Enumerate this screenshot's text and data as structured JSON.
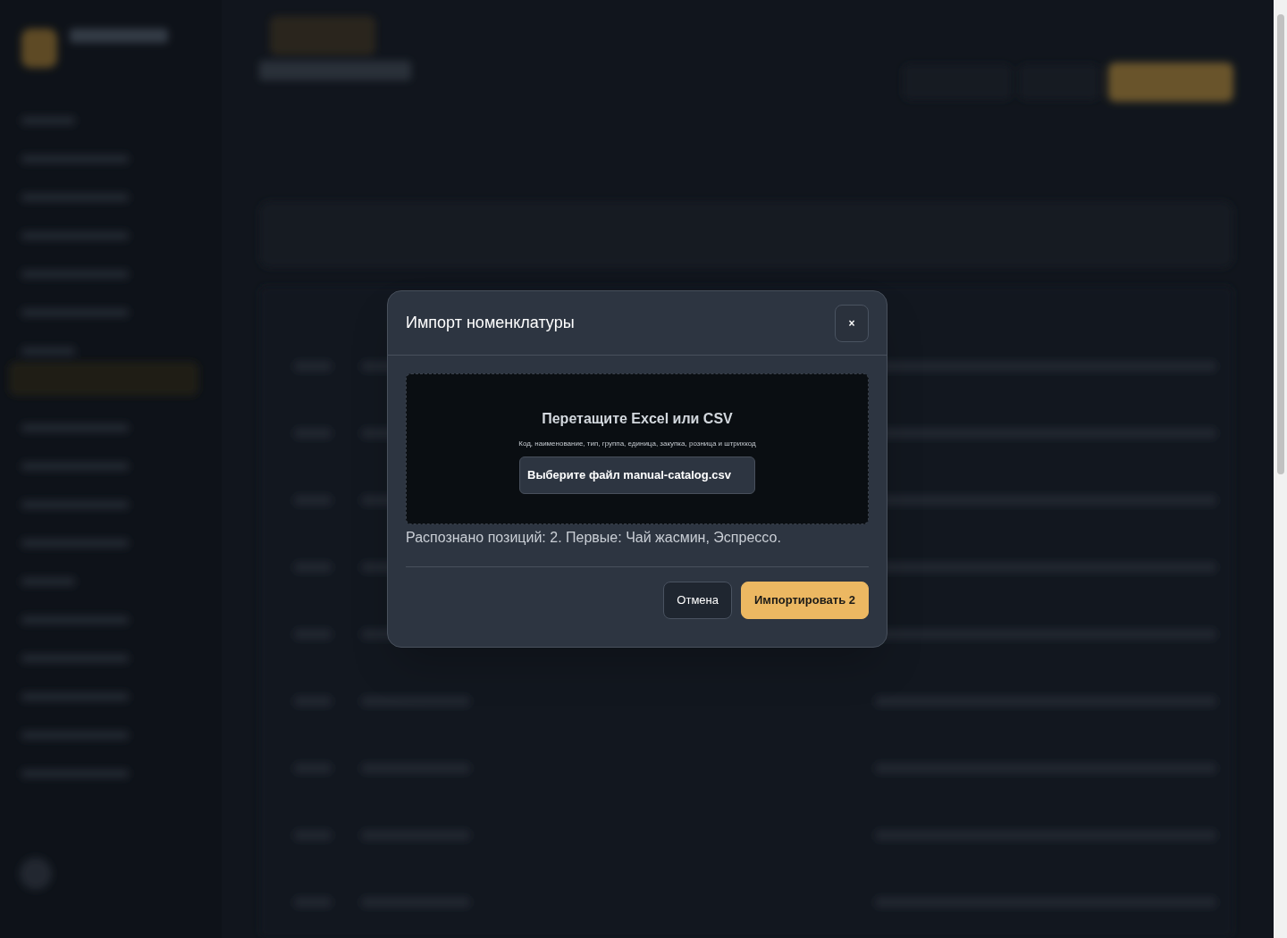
{
  "dialog": {
    "title": "Импорт номенклатуры",
    "close": "×",
    "dropzone": {
      "title": "Перетащите Excel или CSV",
      "hint": "Код, наименование, тип, группа, единица, закупка, розница и штрихкод",
      "file_button": "Выберите файл manual-catalog.csv"
    },
    "status": "Распознано позиций: 2. Первые: Чай жасмин, Эспрессо.",
    "buttons": [
      {
        "label": "Отмена",
        "kind": "secondary"
      },
      {
        "label": "Импортировать 2",
        "kind": "primary"
      }
    ]
  }
}
